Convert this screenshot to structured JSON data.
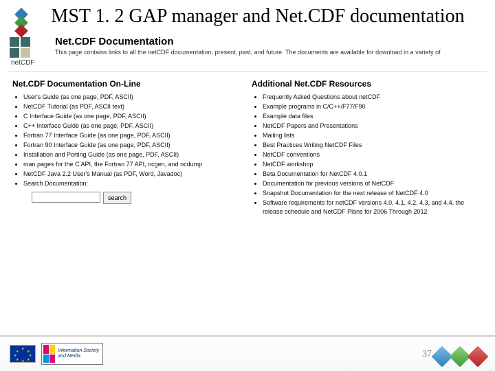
{
  "slide": {
    "title": "MST 1. 2 GAP manager and Net.CDF documentation",
    "page_number": "37"
  },
  "netcdf_header": {
    "title": "Net.CDF Documentation",
    "intro": "This page contains links to all the netCDF documentation, present, past, and future. The documents are available for download in a variety of"
  },
  "left": {
    "heading": "Net.CDF Documentation On-Line",
    "items": [
      "User's Guide (as one page, PDF, ASCII)",
      "NetCDF Tutorial (as PDF, ASCII text)",
      "C Interface Guide (as one page, PDF, ASCII)",
      "C++ Interface Guide (as one page, PDF, ASCII)",
      "Fortran 77 Interface Guide (as one page, PDF, ASCII)",
      "Fortran 90 Interface Guide (as one page, PDF, ASCII)",
      "Installation and Porting Guide (as one page, PDF, ASCII)",
      "man pages for the C API, the Fortran 77 API, ncgen, and ncdump",
      "NetCDF Java 2.2 User's Manual (as PDF, Word, Javadoc)",
      "Search Documentation:"
    ],
    "search_button": "search"
  },
  "right": {
    "heading": "Additional Net.CDF Resources",
    "items": [
      "Frequently Asked Questions about netCDF",
      "Example programs in C/C++/F77/F90",
      "Example data files",
      "NetCDF Papers and Presentations",
      "Mailing lists",
      "Best Practices Writing NetCDF Files",
      "NetCDF conventions",
      "NetCDF workshop",
      "Beta Documentation for NetCDF 4.0.1",
      "Documentation for previous versions of NetCDF",
      "Snapshot Documentation for the next release of NetCDF 4.0",
      "Software requirements for netCDF versions 4.0, 4.1, 4.2, 4.3, and 4.4, the release schedule and NetCDF Plans for 2006 Through 2012"
    ]
  },
  "footer": {
    "ism_label": "Information Society and Media"
  }
}
